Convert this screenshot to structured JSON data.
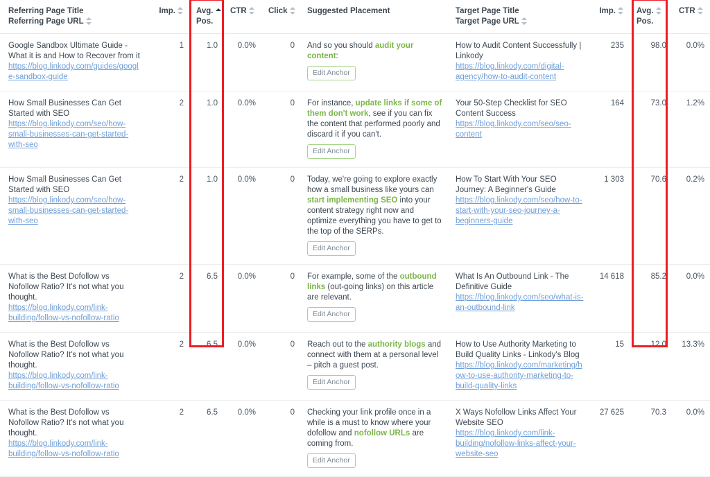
{
  "table": {
    "headers": {
      "referring_page_title": "Referring Page Title",
      "referring_page_url": "Referring Page URL",
      "imp_left": "Imp.",
      "avg_left_1": "Avg.",
      "avg_left_2": "Pos.",
      "ctr_left": "CTR",
      "click": "Click",
      "suggested_placement": "Suggested Placement",
      "target_page_title": "Target Page Title",
      "target_page_url": "Target Page URL",
      "imp_right": "Imp.",
      "avg_right_1": "Avg.",
      "avg_right_2": "Pos.",
      "ctr_right": "CTR"
    },
    "anchor_button_label": "Edit Anchor",
    "sort": {
      "active_column": "avg_pos_left",
      "direction": "asc"
    },
    "rows": [
      {
        "referring_title": "Google Sandbox Ultimate Guide - What it is and How to Recover from it",
        "referring_url": "https://blog.linkody.com/guides/google-sandbox-guide",
        "imp_left": "1",
        "avg_pos_left": "1.0",
        "ctr_left": "0.0%",
        "click": "0",
        "placement_pre": "And so you should ",
        "placement_anchor": "audit your content",
        "placement_post": ":",
        "target_title": "How to Audit Content Successfully | Linkody",
        "target_url": "https://blog.linkody.com/digital-agency/how-to-audit-content",
        "imp_right": "235",
        "avg_pos_right": "98.0",
        "ctr_right": "0.0%"
      },
      {
        "referring_title": "How Small Businesses Can Get Started with SEO",
        "referring_url": "https://blog.linkody.com/seo/how-small-businesses-can-get-started-with-seo",
        "imp_left": "2",
        "avg_pos_left": "1.0",
        "ctr_left": "0.0%",
        "click": "0",
        "placement_pre": "For instance, ",
        "placement_anchor": "update links if some of them don't work",
        "placement_post": ", see if you can fix the content that performed poorly and discard it if you can't.",
        "target_title": "Your 50-Step Checklist for SEO Content Success",
        "target_url": "https://blog.linkody.com/seo/seo-content",
        "imp_right": "164",
        "avg_pos_right": "73.0",
        "ctr_right": "1.2%"
      },
      {
        "referring_title": "How Small Businesses Can Get Started with SEO",
        "referring_url": "https://blog.linkody.com/seo/how-small-businesses-can-get-started-with-seo",
        "imp_left": "2",
        "avg_pos_left": "1.0",
        "ctr_left": "0.0%",
        "click": "0",
        "placement_pre": "Today, we're going to explore exactly how a small business like yours can ",
        "placement_anchor": "start implementing SEO",
        "placement_post": " into your content strategy right now and optimize everything you have to get to the top of the SERPs.",
        "target_title": "How To Start With Your SEO Journey: A Beginner's Guide",
        "target_url": "https://blog.linkody.com/seo/how-to-start-with-your-seo-journey-a-beginners-guide",
        "imp_right": "1 303",
        "avg_pos_right": "70.6",
        "ctr_right": "0.2%"
      },
      {
        "referring_title": "What is the Best Dofollow vs Nofollow Ratio? It's not what you thought.",
        "referring_url": "https://blog.linkody.com/link-building/follow-vs-nofollow-ratio",
        "imp_left": "2",
        "avg_pos_left": "6.5",
        "ctr_left": "0.0%",
        "click": "0",
        "placement_pre": "For example, some of the ",
        "placement_anchor": "outbound links",
        "placement_post": " (out-going links) on this article are relevant.",
        "target_title": "What Is An Outbound Link - The Definitive Guide",
        "target_url": "https://blog.linkody.com/seo/what-is-an-outbound-link",
        "imp_right": "14 618",
        "avg_pos_right": "85.2",
        "ctr_right": "0.0%"
      },
      {
        "referring_title": "What is the Best Dofollow vs Nofollow Ratio? It's not what you thought.",
        "referring_url": "https://blog.linkody.com/link-building/follow-vs-nofollow-ratio",
        "imp_left": "2",
        "avg_pos_left": "6.5",
        "ctr_left": "0.0%",
        "click": "0",
        "placement_pre": "Reach out to the ",
        "placement_anchor": "authority blogs",
        "placement_post": " and connect with them at a personal level – pitch a guest post.",
        "target_title": "How to Use Authority Marketing to Build Quality Links - Linkody's Blog",
        "target_url": "https://blog.linkody.com/marketing/how-to-use-authority-marketing-to-build-quality-links",
        "imp_right": "15",
        "avg_pos_right": "12.0",
        "ctr_right": "13.3%"
      },
      {
        "referring_title": "What is the Best Dofollow vs Nofollow Ratio? It's not what you thought.",
        "referring_url": "https://blog.linkody.com/link-building/follow-vs-nofollow-ratio",
        "imp_left": "2",
        "avg_pos_left": "6.5",
        "ctr_left": "0.0%",
        "click": "0",
        "placement_pre": "Checking your link profile once in a while is a must to know where your dofollow and ",
        "placement_anchor": "nofollow URLs",
        "placement_post": " are coming from.",
        "target_title": "X Ways Nofollow Links Affect Your Website SEO",
        "target_url": "https://blog.linkody.com/link-building/nofollow-links-affect-your-website-seo",
        "imp_right": "27 625",
        "avg_pos_right": "70.3",
        "ctr_right": "0.0%"
      }
    ]
  },
  "annotations": {
    "highlight_color": "#ee1c25",
    "boxes": [
      {
        "name": "avg-pos-left-highlight"
      },
      {
        "name": "avg-pos-right-highlight"
      }
    ]
  }
}
